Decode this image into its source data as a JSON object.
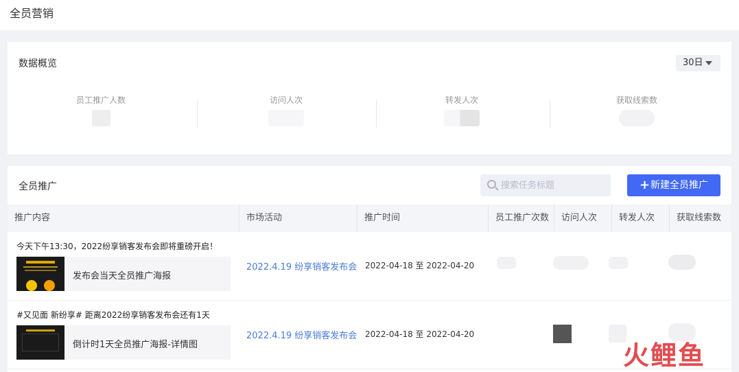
{
  "header": {
    "title": "全员营销"
  },
  "overview": {
    "title": "数据概览",
    "range": "30日",
    "metrics": [
      {
        "label": "员工推广人数"
      },
      {
        "label": "访问人次"
      },
      {
        "label": "转发人次"
      },
      {
        "label": "获取线索数"
      }
    ]
  },
  "promotion": {
    "title": "全员推广",
    "search_placeholder": "搜索任务标题",
    "new_button": "新建全员推广",
    "columns": [
      "推广内容",
      "市场活动",
      "推广时间",
      "员工推广次数",
      "访问人次",
      "转发人次",
      "获取线索数"
    ],
    "rows": [
      {
        "title": "今天下午13:30，2022纷享销客发布会即将重磅开启！",
        "poster": "发布会当天全员推广海报",
        "activity": "2022.4.19 纷享销客发布会",
        "time": "2022-04-18 至 2022-04-20"
      },
      {
        "title": "#又见面 新纷享# 距离2022纷享销客发布会还有1天",
        "poster": "倒计时1天全员推广海报-详情图",
        "activity": "2022.4.19 纷享销客发布会",
        "time": "2022-04-18 至 2022-04-20"
      }
    ]
  },
  "watermark": "火鲤鱼",
  "colors": {
    "primary": "#4269f5",
    "link": "#4a7bd8",
    "watermark": "#e0393e"
  }
}
